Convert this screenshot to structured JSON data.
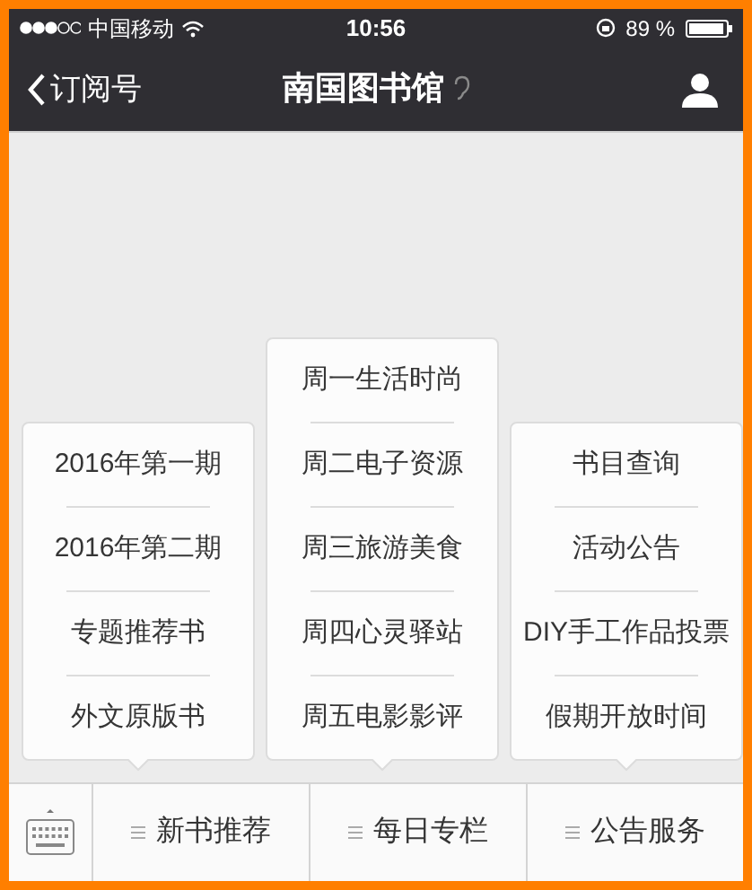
{
  "status_bar": {
    "carrier": "中国移动",
    "time": "10:56",
    "battery": "89 %"
  },
  "nav_bar": {
    "back_label": "订阅号",
    "title": "南国图书馆"
  },
  "menus": [
    {
      "label": "新书推荐",
      "items": [
        "2016年第一期",
        "2016年第二期",
        "专题推荐书",
        "外文原版书"
      ]
    },
    {
      "label": "每日专栏",
      "items": [
        "周一生活时尚",
        "周二电子资源",
        "周三旅游美食",
        "周四心灵驿站",
        "周五电影影评"
      ]
    },
    {
      "label": "公告服务",
      "items": [
        "书目查询",
        "活动公告",
        "DIY手工作品投票",
        "假期开放时间"
      ]
    }
  ]
}
